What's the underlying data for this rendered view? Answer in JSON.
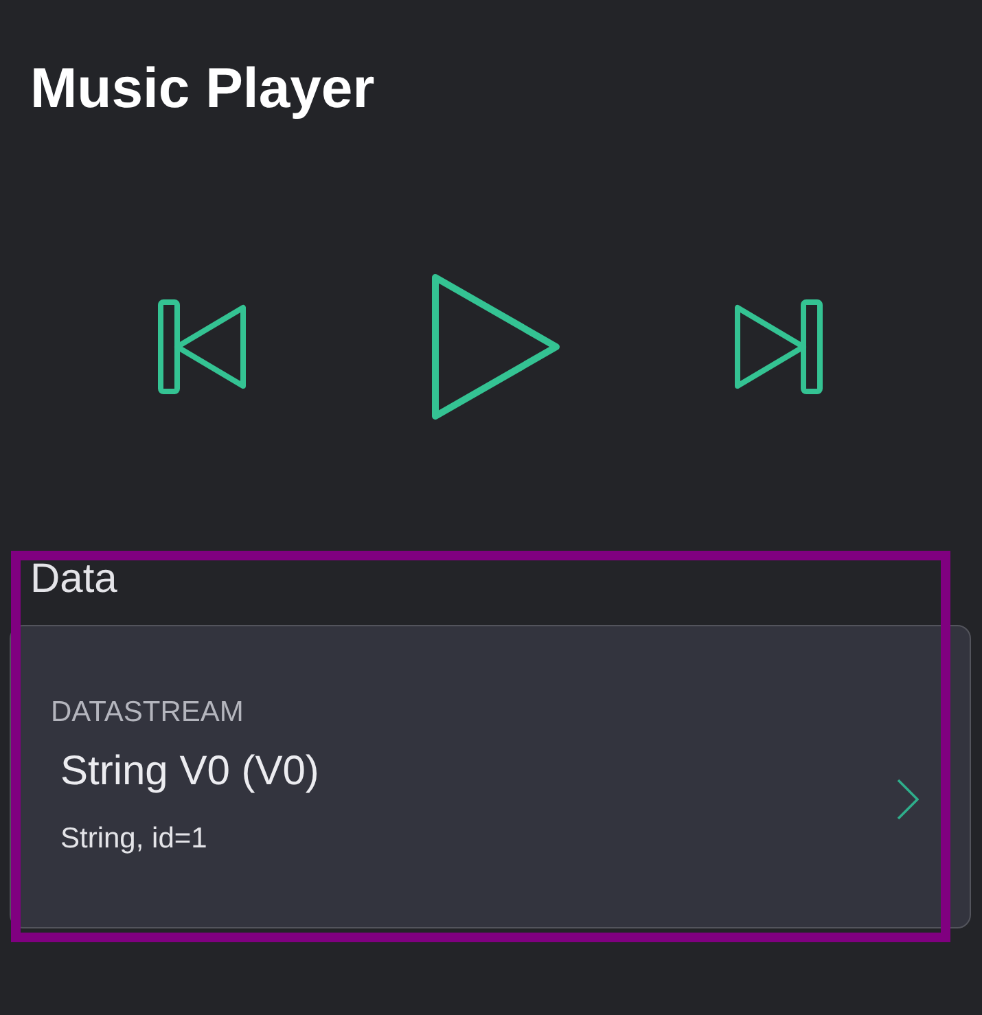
{
  "title": "Music Player",
  "controls": [
    {
      "kind": "previous"
    },
    {
      "kind": "play"
    },
    {
      "kind": "next"
    }
  ],
  "data_section": {
    "title": "Data",
    "highlighted": true,
    "items": [
      {
        "label": "DATASTREAM",
        "name": "String V0 (V0)",
        "detail": "String, id=1"
      }
    ]
  }
}
